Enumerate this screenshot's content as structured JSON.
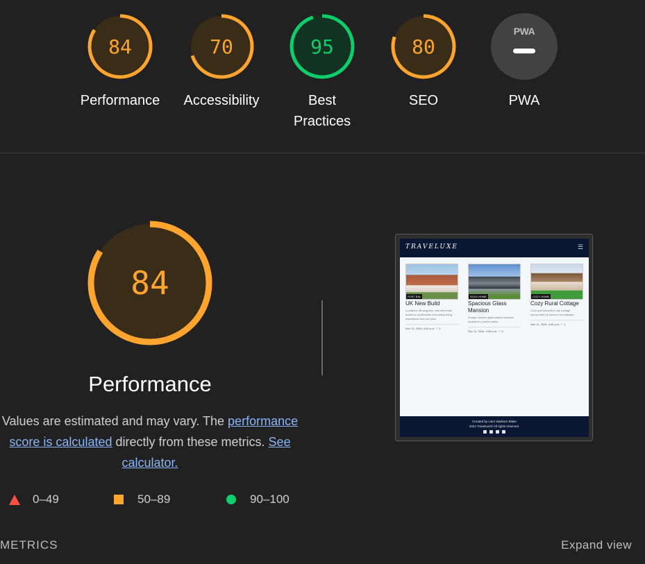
{
  "scores": [
    {
      "label": "Performance",
      "value": 84,
      "color": "#ffa42e",
      "bg": "#3a2d18"
    },
    {
      "label": "Accessibility",
      "value": 70,
      "color": "#ffa42e",
      "bg": "#3a2d18"
    },
    {
      "label": "Best\nPractices",
      "value": 95,
      "color": "#0cce6b",
      "bg": "#123322"
    },
    {
      "label": "SEO",
      "value": 80,
      "color": "#ffa42e",
      "bg": "#3a2d18"
    },
    {
      "label": "PWA",
      "badge": "PWA"
    }
  ],
  "score_labels": {
    "performance": "Performance",
    "accessibility": "Accessibility",
    "best_1": "Best",
    "best_2": "Practices",
    "seo": "SEO",
    "pwa": "PWA"
  },
  "score_values": {
    "performance": "84",
    "accessibility": "70",
    "best": "95",
    "seo": "80",
    "pwa_badge": "PWA"
  },
  "detail": {
    "score": "84",
    "score_value": 84,
    "title": "Performance",
    "desc_1": "Values are estimated and may vary. The ",
    "link_1": "performance score is calculated",
    "desc_2": " directly from these metrics. ",
    "link_2": "See calculator."
  },
  "legend": {
    "fail": "0–49",
    "average": "50–89",
    "pass": "90–100"
  },
  "metrics_label": "METRICS",
  "expand_label": "Expand view",
  "screenshot": {
    "logo": "TRAVELUXE",
    "cards": [
      {
        "tag": "POST BIN",
        "title": "UK New Build",
        "text": "Located in Brookgreen, this new build boasts a comfortable and classy living experience and low price.",
        "meta": "Dec 11, 2024, 4:05 p.m. ♡ 2"
      },
      {
        "tag": "SOLD HOME",
        "title": "Spacious Glass Mansion",
        "text": "A large modern glass-based mansion located in a lavish valley.",
        "meta": "Dec 11, 2024, 4:08 p.m. ♡ 0"
      },
      {
        "tag": "COZY HOME",
        "title": "Cozy Rural Cottage",
        "text": "Cozy and secluded rural cottage surrounded by forest in countryside.",
        "meta": "Dec 11, 2024, 4:05 p.m. ♡ 1"
      }
    ],
    "footer_1": "Created by Liam Warburn Blake",
    "footer_2": "2024 Traveluxe© All rights reserved."
  },
  "colors": {
    "average": "#ffa42e",
    "pass": "#0cce6b",
    "fail": "#ff4e42",
    "link": "#8ab4f8"
  }
}
